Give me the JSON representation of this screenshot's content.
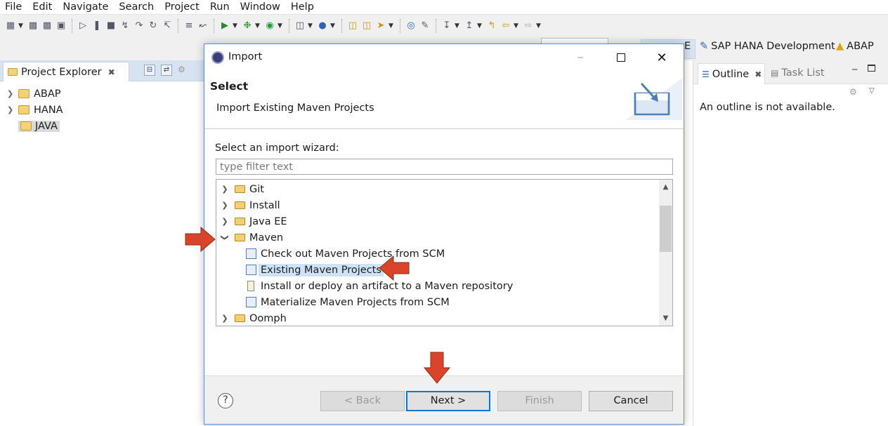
{
  "menu": [
    "File",
    "Edit",
    "Navigate",
    "Search",
    "Project",
    "Run",
    "Window",
    "Help"
  ],
  "perspectives": {
    "partial": "E",
    "sap_hana": "SAP HANA Development",
    "abap": "ABAP"
  },
  "project_explorer": {
    "tab": "Project Explorer",
    "items": [
      "ABAP",
      "HANA",
      "JAVA"
    ]
  },
  "outline": {
    "tab": "Outline",
    "tab2": "Task List",
    "message": "An outline is not available."
  },
  "dialog": {
    "title": "Import",
    "banner_title": "Select",
    "banner_desc": "Import Existing Maven Projects",
    "wizard_label": "Select an import wizard:",
    "filter_placeholder": "type filter text",
    "tree": {
      "git": "Git",
      "install": "Install",
      "javaee": "Java EE",
      "maven": "Maven",
      "maven_children": [
        "Check out Maven Projects from SCM",
        "Existing Maven Projects",
        "Install or deploy an artifact to a Maven repository",
        "Materialize Maven Projects from SCM"
      ],
      "oomph": "Oomph"
    },
    "buttons": {
      "help": "?",
      "back": "< Back",
      "next": "Next >",
      "finish": "Finish",
      "cancel": "Cancel"
    }
  },
  "colors": {
    "accent": "#0078d7",
    "arrow": "#d9452b",
    "selection": "#cfe3f7"
  }
}
